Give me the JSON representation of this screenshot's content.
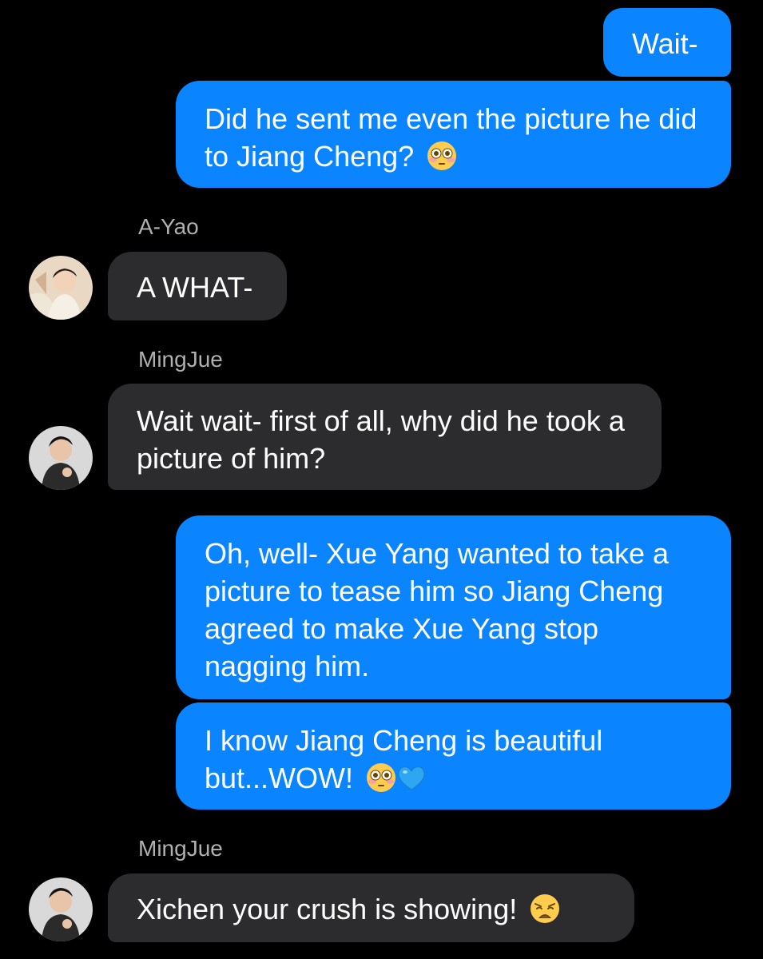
{
  "conversation": {
    "messages": [
      {
        "type": "sent",
        "text": "Wait-"
      },
      {
        "type": "sent",
        "text": "Did he sent me even the picture he did to Jiang Cheng?",
        "emoji": [
          "flushed-face"
        ]
      },
      {
        "type": "received",
        "sender": "A-Yao",
        "text": "A WHAT-"
      },
      {
        "type": "received",
        "sender": "MingJue",
        "text": "Wait wait- first of all, why did he took a picture of him?"
      },
      {
        "type": "sent",
        "text": "Oh, well- Xue Yang wanted to take a picture to tease him so Jiang Cheng agreed to make Xue Yang stop nagging him."
      },
      {
        "type": "sent",
        "text": "I know Jiang Cheng is beautiful but...WOW!",
        "emoji": [
          "flushed-face",
          "blue-heart"
        ]
      },
      {
        "type": "received",
        "sender": "MingJue",
        "text": "Xichen your crush is showing!",
        "emoji": [
          "weary-face"
        ]
      }
    ]
  },
  "colors": {
    "background": "#000000",
    "sent_bubble": "#0a84ff",
    "received_bubble": "#2c2c2e",
    "sender_name": "#b0b0b0",
    "text": "#ffffff"
  }
}
